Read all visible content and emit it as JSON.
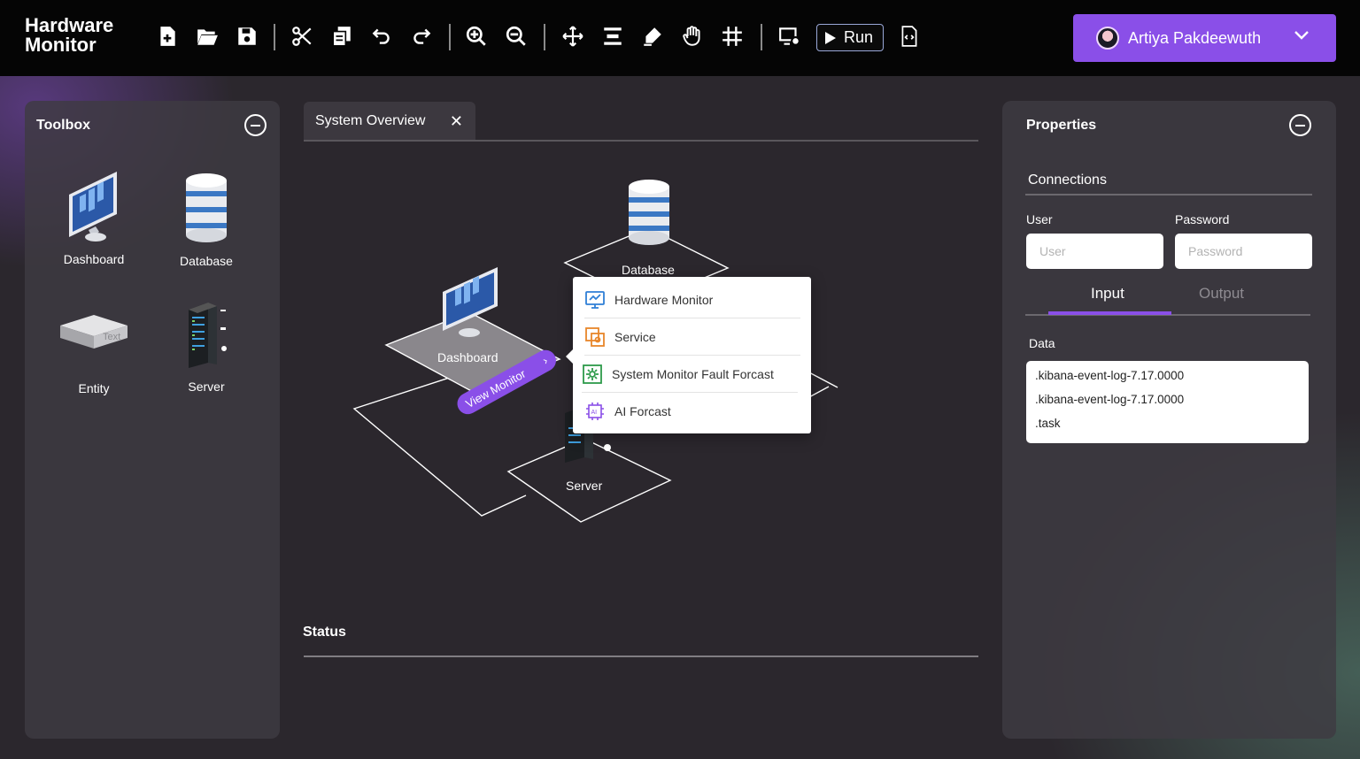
{
  "app": {
    "title": "Hardware Monitor"
  },
  "toolbar": {
    "icons": [
      "new-file-icon",
      "open-folder-icon",
      "save-icon",
      "cut-icon",
      "copy-icon",
      "undo-icon",
      "redo-icon",
      "zoom-in-icon",
      "zoom-out-icon",
      "move-icon",
      "align-icon",
      "draw-icon",
      "hand-icon",
      "grid-icon",
      "screen-add-icon",
      "run-icon",
      "code-file-icon"
    ],
    "run_label": "Run"
  },
  "user": {
    "name": "Artiya Pakdeewuth"
  },
  "toolbox": {
    "title": "Toolbox",
    "items": [
      {
        "label": "Dashboard",
        "icon": "monitor-icon"
      },
      {
        "label": "Database",
        "icon": "database-icon"
      },
      {
        "label": "Entity",
        "icon": "entity-box-icon",
        "icon_text": "Text"
      },
      {
        "label": "Server",
        "icon": "server-rack-icon"
      }
    ]
  },
  "canvas": {
    "tab_label": "System Overview",
    "nodes": {
      "database": "Database",
      "dashboard": "Dashboard",
      "server": "Server"
    },
    "view_monitor_label": "View Monitor",
    "context_menu": [
      {
        "label": "Hardware Monitor",
        "icon": "monitor-chart-icon"
      },
      {
        "label": "Service",
        "icon": "service-icon"
      },
      {
        "label": "System Monitor Fault Forcast",
        "icon": "fault-gear-icon"
      },
      {
        "label": "AI Forcast",
        "icon": "ai-chip-icon"
      }
    ],
    "status_title": "Status"
  },
  "properties": {
    "title": "Properties",
    "section": "Connections",
    "user_label": "User",
    "user_placeholder": "User",
    "password_label": "Password",
    "password_placeholder": "Password",
    "tabs": [
      "Input",
      "Output"
    ],
    "active_tab": "Input",
    "data_label": "Data",
    "data_lines": [
      ".kibana-event-log-7.17.0000",
      ".kibana-event-log-7.17.0000",
      ".task"
    ]
  },
  "colors": {
    "accent": "#8a4fe8",
    "topbar": "#050505",
    "background": "#2b272d"
  }
}
